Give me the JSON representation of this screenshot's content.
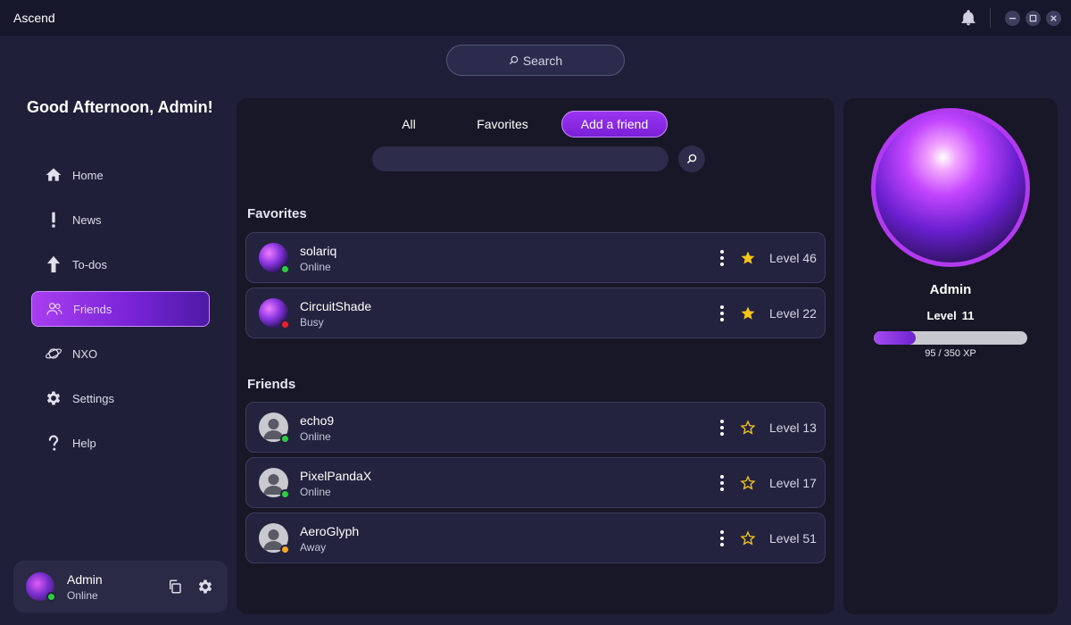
{
  "app": {
    "title": "Ascend"
  },
  "search": {
    "label": "Search"
  },
  "greeting": "Good Afternoon, Admin!",
  "sidebar": {
    "items": [
      {
        "label": "Home",
        "icon": "home-icon"
      },
      {
        "label": "News",
        "icon": "exclamation-icon"
      },
      {
        "label": "To-dos",
        "icon": "arrow-up-icon"
      },
      {
        "label": "Friends",
        "icon": "users-icon",
        "active": true
      },
      {
        "label": "NXO",
        "icon": "planet-icon"
      },
      {
        "label": "Settings",
        "icon": "gear-icon"
      },
      {
        "label": "Help",
        "icon": "question-icon"
      }
    ]
  },
  "user_card": {
    "name": "Admin",
    "status": "Online"
  },
  "tabs": [
    {
      "label": "All"
    },
    {
      "label": "Favorites"
    },
    {
      "label": "Add a friend",
      "active": true
    }
  ],
  "friend_search": {
    "placeholder": ""
  },
  "favorites": {
    "title": "Favorites",
    "items": [
      {
        "name": "solariq",
        "status": "Online",
        "level": "Level 46",
        "favorite": true,
        "status_color": "#2ecc40",
        "avatar": "image"
      },
      {
        "name": "CircuitShade",
        "status": "Busy",
        "level": "Level 22",
        "favorite": true,
        "status_color": "#e8202a",
        "avatar": "image"
      }
    ]
  },
  "friends": {
    "title": "Friends",
    "items": [
      {
        "name": "echo9",
        "status": "Online",
        "level": "Level 13",
        "favorite": false,
        "status_color": "#2ecc40",
        "avatar": "default"
      },
      {
        "name": "PixelPandaX",
        "status": "Online",
        "level": "Level 17",
        "favorite": false,
        "status_color": "#2ecc40",
        "avatar": "default"
      },
      {
        "name": "AeroGlyph",
        "status": "Away",
        "level": "Level 51",
        "favorite": false,
        "status_color": "#f5a623",
        "avatar": "default"
      }
    ]
  },
  "profile": {
    "name": "Admin",
    "level_label": "Level",
    "level_value": "11",
    "xp_text": "95 / 350 XP",
    "xp_current": 95,
    "xp_max": 350
  },
  "colors": {
    "accent": "#9b34f0",
    "star": "#f5c518",
    "online": "#2ecc40",
    "busy": "#e8202a",
    "away": "#f5a623"
  }
}
